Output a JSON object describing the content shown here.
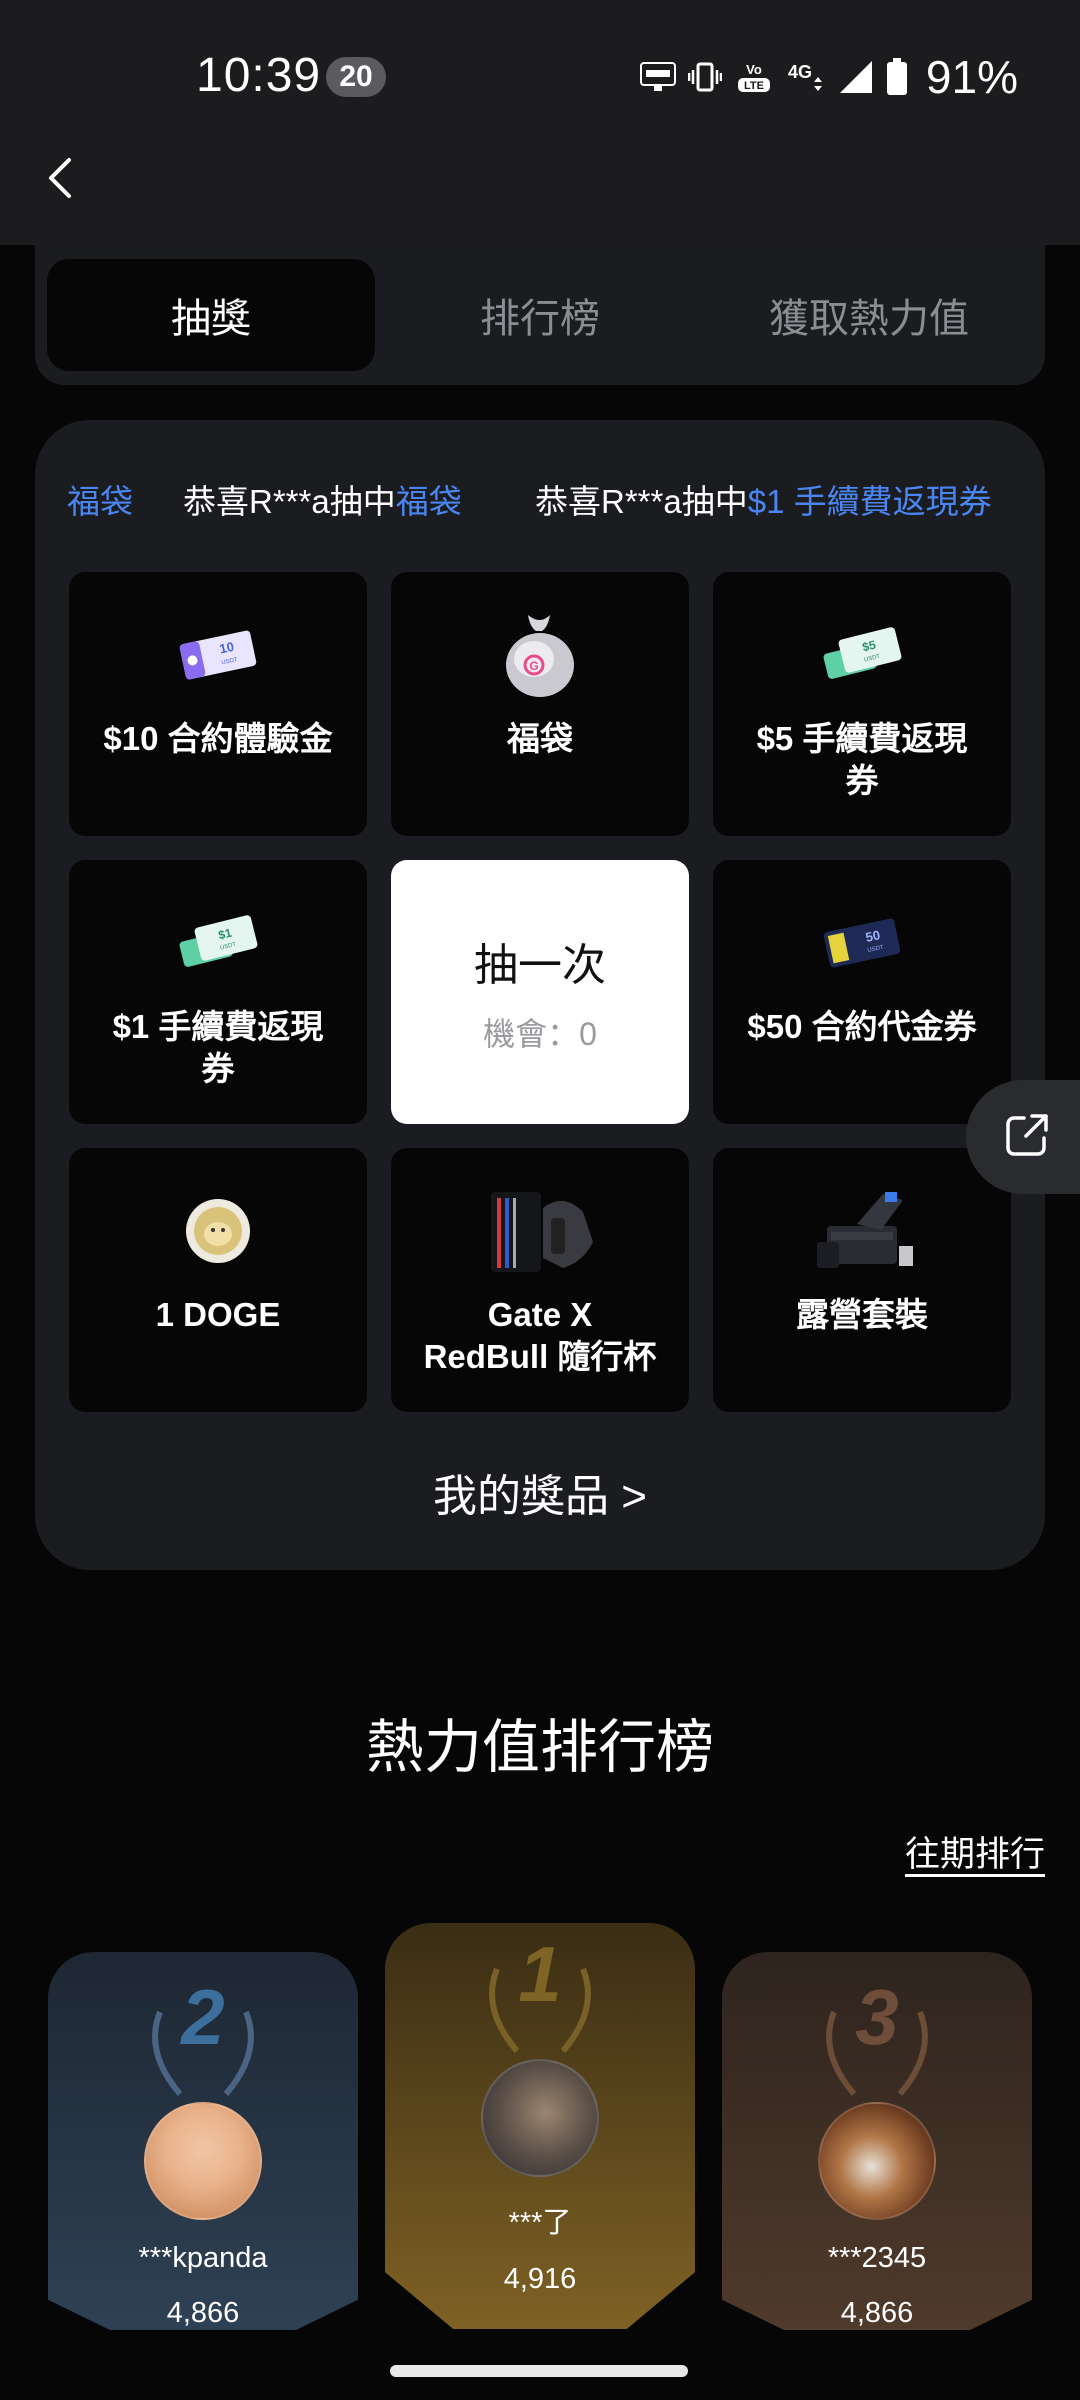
{
  "status_bar": {
    "time": "10:39",
    "notification_count": "20",
    "icons": [
      "auto-hz-icon",
      "vibrate-icon",
      "volte-icon",
      "4g-icon",
      "signal-icon",
      "battery-icon"
    ],
    "volte_label": "Vo LTE",
    "network_label": "4G",
    "battery_percent": "91%"
  },
  "tabs": [
    {
      "label": "抽獎",
      "active": true
    },
    {
      "label": "排行榜",
      "active": false
    },
    {
      "label": "獲取熱力值",
      "active": false
    }
  ],
  "ticker": [
    {
      "prefix": "",
      "highlight": "福袋"
    },
    {
      "prefix": "恭喜R***a抽中",
      "highlight": "福袋"
    },
    {
      "prefix": "恭喜R***a抽中",
      "highlight": "$1 手續費返現券"
    }
  ],
  "prizes": [
    {
      "label": "$10 合約體驗金",
      "icon": "ticket-10-usdt-icon",
      "ticket_text": "10",
      "ticket_unit": "USDT"
    },
    {
      "label": "福袋",
      "icon": "lucky-bag-icon",
      "badge_text": "G"
    },
    {
      "label": "$5 手續費返現券",
      "icon": "cashback-5-icon",
      "ticket_text": "$5",
      "ticket_unit": "USDT"
    },
    {
      "label": "$1 手續費返現券",
      "icon": "cashback-1-icon",
      "ticket_text": "$1",
      "ticket_unit": "USDT"
    },
    {
      "label": "$50 合約代金券",
      "icon": "voucher-50-icon",
      "ticket_text": "50",
      "ticket_unit": "USDT"
    },
    {
      "label": "1 DOGE",
      "icon": "doge-coin-icon"
    },
    {
      "label": "Gate X RedBull 隨行杯",
      "icon": "tumbler-icon"
    },
    {
      "label": "露營套裝",
      "icon": "camping-set-icon"
    }
  ],
  "draw": {
    "title": "抽一次",
    "chances": "機會：0"
  },
  "my_prizes_link": "我的獎品 >",
  "ranking": {
    "title": "熱力值排行榜",
    "history_link": "往期排行",
    "podium": [
      {
        "rank": "2",
        "name": "***kpanda",
        "score": "4,866",
        "color": "#3d5a78"
      },
      {
        "rank": "1",
        "name": "***了",
        "score": "4,916",
        "color": "#a07f3c"
      },
      {
        "rank": "3",
        "name": "***2345",
        "score": "4,866",
        "color": "#7a5a44"
      }
    ]
  },
  "colors": {
    "accent": "#4a86f3",
    "background": "#060606",
    "card": "#1b1c1f"
  }
}
